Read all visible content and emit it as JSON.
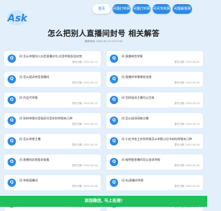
{
  "brand": {
    "accent": "#2a8ae6",
    "cta_color": "#1fbf5a",
    "logo_text": "Ask"
  },
  "nav": [
    "首页",
    "问题打听网",
    "问题打听网",
    "问问专利网",
    "问题解答网"
  ],
  "page_title": "怎么把别人直播间封号 相关解答",
  "updated": "更新时间: 2025-05-13 15:17:54",
  "cards": [
    {
      "q": "问:怎么举报别人抖音直播封号,抖音举报多话封禁",
      "date": "提问日期: 2025-05-13"
    },
    {
      "q": "问:直播带货举报",
      "date": "提问日期: 2025-04-01"
    },
    {
      "q": "问:怎么投诉快音直播间",
      "date": "提问日期: 2025-05-13"
    },
    {
      "q": "问:直播间举报哪些违规",
      "date": "提问日期: 2025-05-05"
    },
    {
      "q": "问:作品代举报",
      "date": "提问日期: 2025-05-13"
    },
    {
      "q": "问:怎样投诉主播可以生效",
      "date": "提问日期: 2025-04-23"
    },
    {
      "q": "问:如何举报抖音投诉抖音如何举报有几种",
      "date": "提问日期: 2025-05-03"
    },
    {
      "q": "问:怎么投诉网络主播",
      "date": "提问日期: 2025-05-23"
    },
    {
      "q": "问:怎么举报主播",
      "date": "提问日期: 2025-04-09"
    },
    {
      "q": "问:小红书技工作所举报怎么举报小红书如何举报有几种",
      "date": "提问日期: 2025-04-09"
    },
    {
      "q": "问:直播间封禁投诉查看",
      "date": "提问日期: 2025-04-04"
    },
    {
      "q": "问:被明星直播间怎么投诉举报",
      "date": "提问日期: 2025-04-05"
    },
    {
      "q": "问:举报直播间",
      "date": "提问日期: 2025-04-06"
    },
    {
      "q": "问:dy直播间举报",
      "date": "提问日期: 2025-03-20"
    },
    {
      "q": "问:为什么主播又色情直播",
      "date": "提问日期: 2025-04-03"
    },
    {
      "q": "问:怎样举报逐渐的快手网投诉违规怎么办",
      "date": "提问日期: 2025-05-17"
    }
  ],
  "cta_label": "添加微信, 马上处理!"
}
